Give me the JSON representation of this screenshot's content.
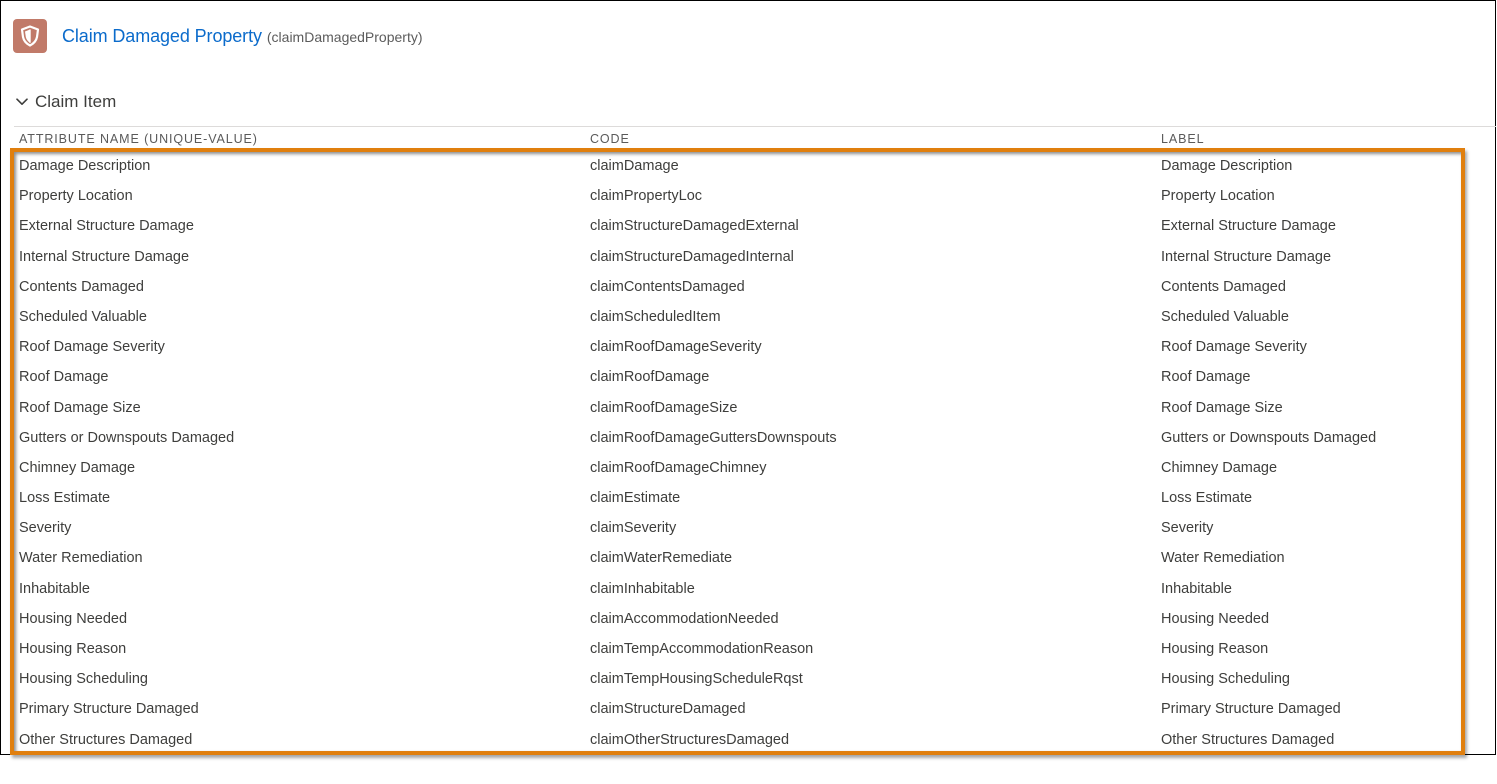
{
  "header": {
    "icon": "shield-icon",
    "icon_color": "#c17a69",
    "title": "Claim Damaged Property",
    "api_name": "(claimDamagedProperty)",
    "title_color": "#0b6bcb"
  },
  "section": {
    "chevron": "chevron-down-icon",
    "title": "Claim Item"
  },
  "table": {
    "columns": [
      "ATTRIBUTE NAME (UNIQUE-VALUE)",
      "CODE",
      "LABEL"
    ],
    "highlight_color": "#e07f0e",
    "rows": [
      {
        "name": "Damage Description",
        "code": "claimDamage",
        "label": "Damage Description"
      },
      {
        "name": "Property Location",
        "code": "claimPropertyLoc",
        "label": "Property Location"
      },
      {
        "name": "External Structure Damage",
        "code": "claimStructureDamagedExternal",
        "label": "External Structure Damage"
      },
      {
        "name": "Internal Structure Damage",
        "code": "claimStructureDamagedInternal",
        "label": "Internal Structure Damage"
      },
      {
        "name": "Contents Damaged",
        "code": "claimContentsDamaged",
        "label": "Contents Damaged"
      },
      {
        "name": "Scheduled Valuable",
        "code": "claimScheduledItem",
        "label": "Scheduled Valuable"
      },
      {
        "name": "Roof Damage Severity",
        "code": "claimRoofDamageSeverity",
        "label": "Roof Damage Severity"
      },
      {
        "name": "Roof Damage",
        "code": "claimRoofDamage",
        "label": "Roof Damage"
      },
      {
        "name": "Roof Damage Size",
        "code": "claimRoofDamageSize",
        "label": "Roof Damage Size"
      },
      {
        "name": "Gutters or Downspouts Damaged",
        "code": "claimRoofDamageGuttersDownspouts",
        "label": "Gutters or Downspouts Damaged"
      },
      {
        "name": "Chimney Damage",
        "code": "claimRoofDamageChimney",
        "label": "Chimney Damage"
      },
      {
        "name": "Loss Estimate",
        "code": "claimEstimate",
        "label": "Loss Estimate"
      },
      {
        "name": "Severity",
        "code": "claimSeverity",
        "label": "Severity"
      },
      {
        "name": "Water Remediation",
        "code": "claimWaterRemediate",
        "label": "Water Remediation"
      },
      {
        "name": "Inhabitable",
        "code": "claimInhabitable",
        "label": "Inhabitable"
      },
      {
        "name": "Housing Needed",
        "code": "claimAccommodationNeeded",
        "label": "Housing Needed"
      },
      {
        "name": "Housing Reason",
        "code": "claimTempAccommodationReason",
        "label": "Housing Reason"
      },
      {
        "name": "Housing Scheduling",
        "code": "claimTempHousingScheduleRqst",
        "label": "Housing Scheduling"
      },
      {
        "name": "Primary Structure Damaged",
        "code": "claimStructureDamaged",
        "label": "Primary Structure Damaged"
      },
      {
        "name": "Other Structures Damaged",
        "code": "claimOtherStructuresDamaged",
        "label": "Other Structures Damaged"
      }
    ]
  }
}
